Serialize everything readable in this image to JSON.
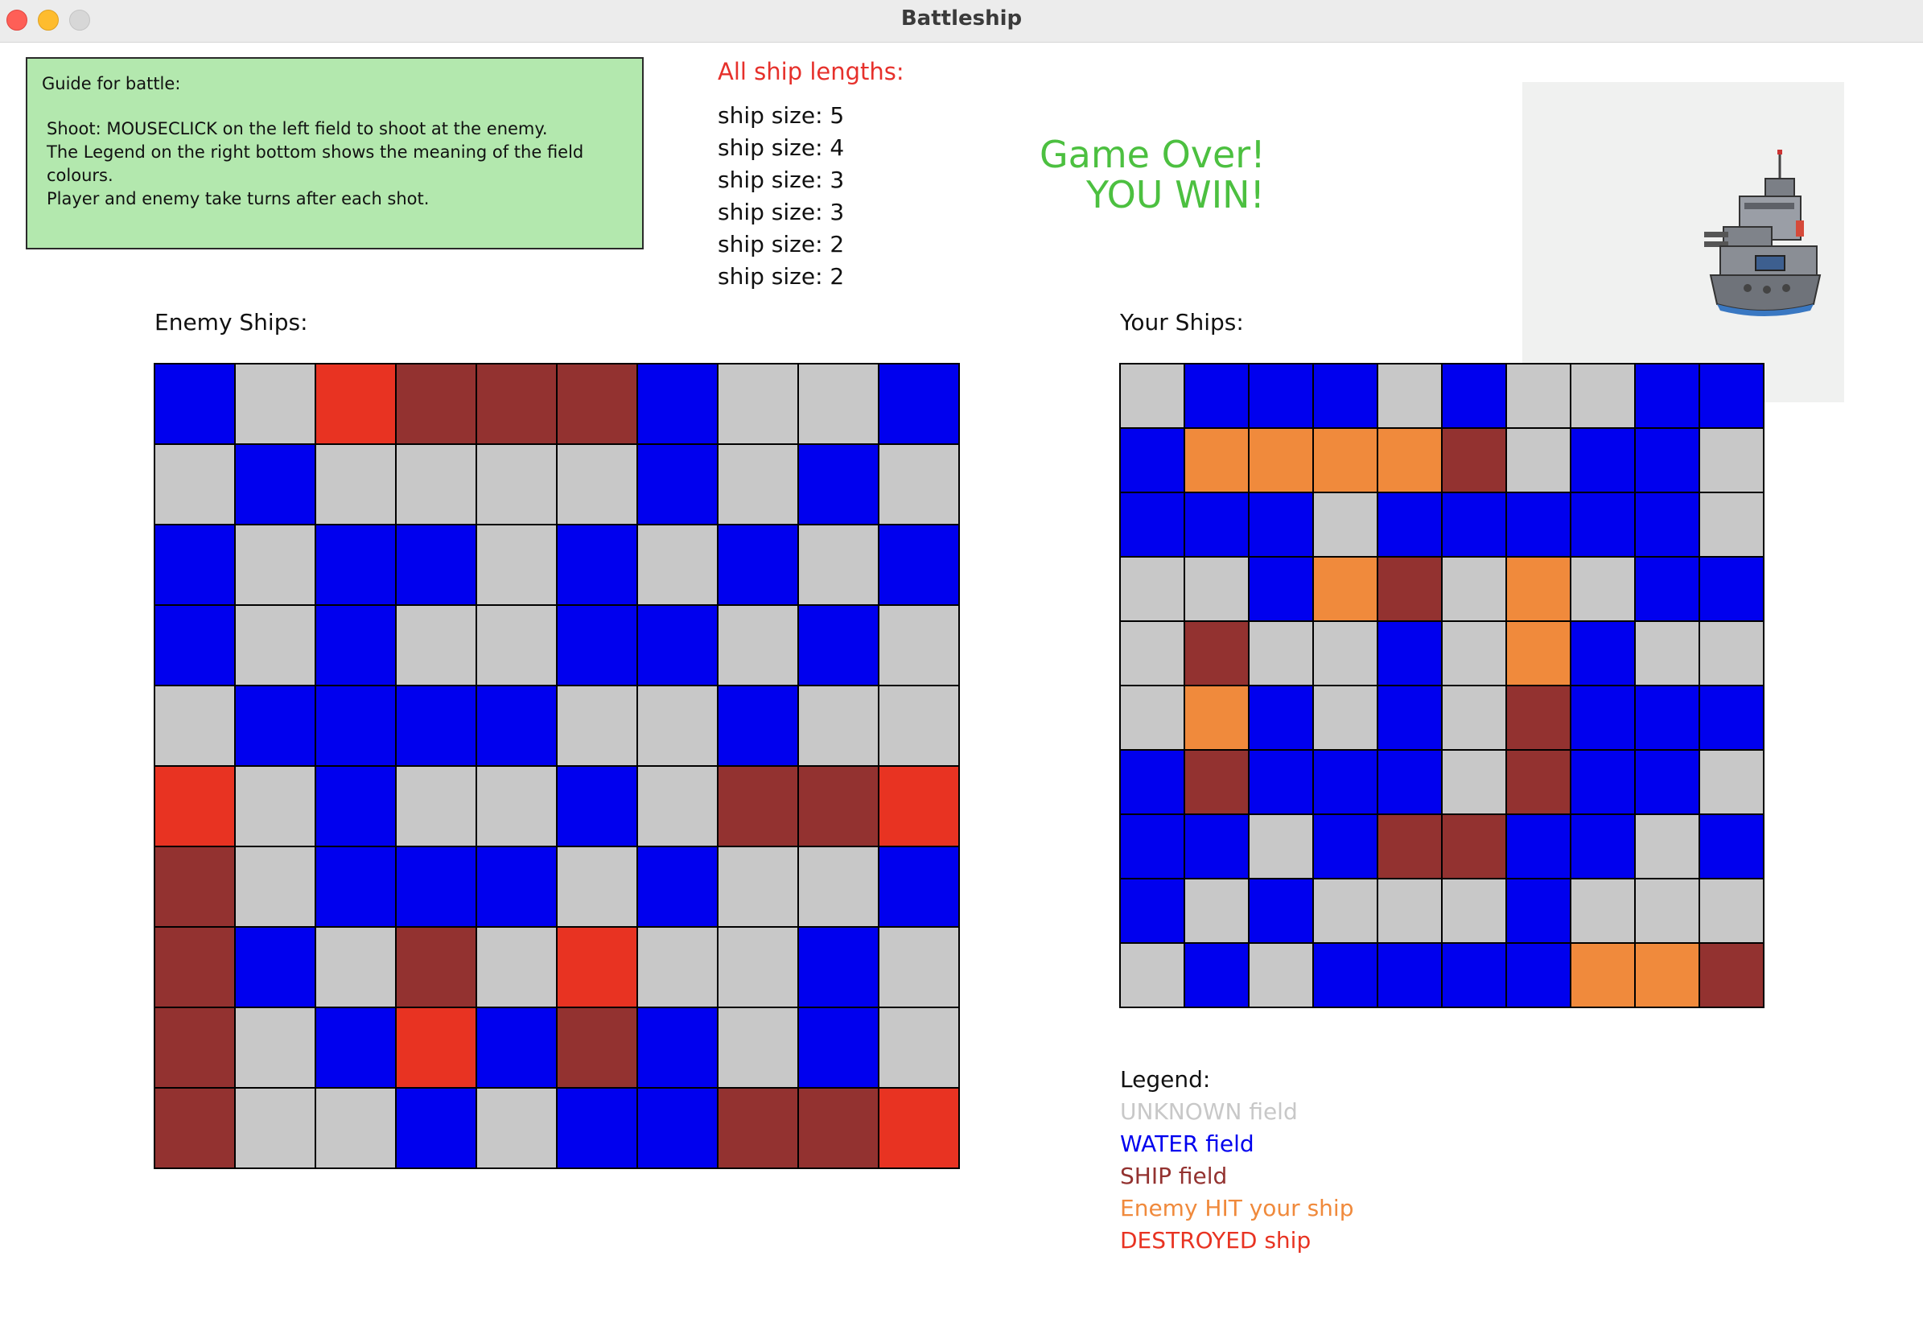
{
  "window": {
    "title": "Battleship"
  },
  "guide": {
    "title": "Guide for battle:",
    "lines": [
      "Shoot: MOUSECLICK on the left field to shoot at the enemy.",
      "The Legend on the right bottom shows the meaning of the field colours.",
      "Player and enemy take turns after each shot."
    ]
  },
  "ships": {
    "title": "All ship lengths:",
    "items": [
      "ship size: 5",
      "ship size: 4",
      "ship size: 3",
      "ship size: 3",
      "ship size: 2",
      "ship size: 2"
    ]
  },
  "status": {
    "line1": "Game Over!",
    "line2": "YOU WIN!"
  },
  "colors": {
    "unknown": "#c8c8c8",
    "water": "#0000ee",
    "ship": "#933230",
    "hit": "#f08a3c",
    "destroyed": "#e83322"
  },
  "enemy_board": {
    "label": "Enemy Ships:",
    "rows": [
      [
        "water",
        "unknown",
        "destroyed",
        "ship",
        "ship",
        "ship",
        "water",
        "unknown",
        "unknown",
        "water"
      ],
      [
        "unknown",
        "water",
        "unknown",
        "unknown",
        "unknown",
        "unknown",
        "water",
        "unknown",
        "water",
        "unknown"
      ],
      [
        "water",
        "unknown",
        "water",
        "water",
        "unknown",
        "water",
        "unknown",
        "water",
        "unknown",
        "water"
      ],
      [
        "water",
        "unknown",
        "water",
        "unknown",
        "unknown",
        "water",
        "water",
        "unknown",
        "water",
        "unknown"
      ],
      [
        "unknown",
        "water",
        "water",
        "water",
        "water",
        "unknown",
        "unknown",
        "water",
        "unknown",
        "unknown"
      ],
      [
        "destroyed",
        "unknown",
        "water",
        "unknown",
        "unknown",
        "water",
        "unknown",
        "ship",
        "ship",
        "destroyed"
      ],
      [
        "ship",
        "unknown",
        "water",
        "water",
        "water",
        "unknown",
        "water",
        "unknown",
        "unknown",
        "water"
      ],
      [
        "ship",
        "water",
        "unknown",
        "ship",
        "unknown",
        "destroyed",
        "unknown",
        "unknown",
        "water",
        "unknown"
      ],
      [
        "ship",
        "unknown",
        "water",
        "destroyed",
        "water",
        "ship",
        "water",
        "unknown",
        "water",
        "unknown"
      ],
      [
        "ship",
        "unknown",
        "unknown",
        "water",
        "unknown",
        "water",
        "water",
        "ship",
        "ship",
        "destroyed"
      ]
    ]
  },
  "own_board": {
    "label": "Your Ships:",
    "rows": [
      [
        "unknown",
        "water",
        "water",
        "water",
        "unknown",
        "water",
        "unknown",
        "unknown",
        "water",
        "water"
      ],
      [
        "water",
        "hit",
        "hit",
        "hit",
        "hit",
        "ship",
        "unknown",
        "water",
        "water",
        "unknown"
      ],
      [
        "water",
        "water",
        "water",
        "unknown",
        "water",
        "water",
        "water",
        "water",
        "water",
        "unknown"
      ],
      [
        "unknown",
        "unknown",
        "water",
        "hit",
        "ship",
        "unknown",
        "hit",
        "unknown",
        "water",
        "water"
      ],
      [
        "unknown",
        "ship",
        "unknown",
        "unknown",
        "water",
        "unknown",
        "hit",
        "water",
        "unknown",
        "unknown"
      ],
      [
        "unknown",
        "hit",
        "water",
        "unknown",
        "water",
        "unknown",
        "ship",
        "water",
        "water",
        "water"
      ],
      [
        "water",
        "ship",
        "water",
        "water",
        "water",
        "unknown",
        "ship",
        "water",
        "water",
        "unknown"
      ],
      [
        "water",
        "water",
        "unknown",
        "water",
        "ship",
        "ship",
        "water",
        "water",
        "unknown",
        "water"
      ],
      [
        "water",
        "unknown",
        "water",
        "unknown",
        "unknown",
        "unknown",
        "water",
        "unknown",
        "unknown",
        "unknown"
      ],
      [
        "unknown",
        "water",
        "unknown",
        "water",
        "water",
        "water",
        "water",
        "hit",
        "hit",
        "ship"
      ]
    ]
  },
  "legend": {
    "title": "Legend:",
    "items": [
      {
        "text": "UNKNOWN field",
        "key": "unknown"
      },
      {
        "text": "WATER field",
        "key": "water"
      },
      {
        "text": "SHIP field",
        "key": "ship"
      },
      {
        "text": "Enemy HIT your ship",
        "key": "hit"
      },
      {
        "text": "DESTROYED ship",
        "key": "destroyed"
      }
    ]
  }
}
